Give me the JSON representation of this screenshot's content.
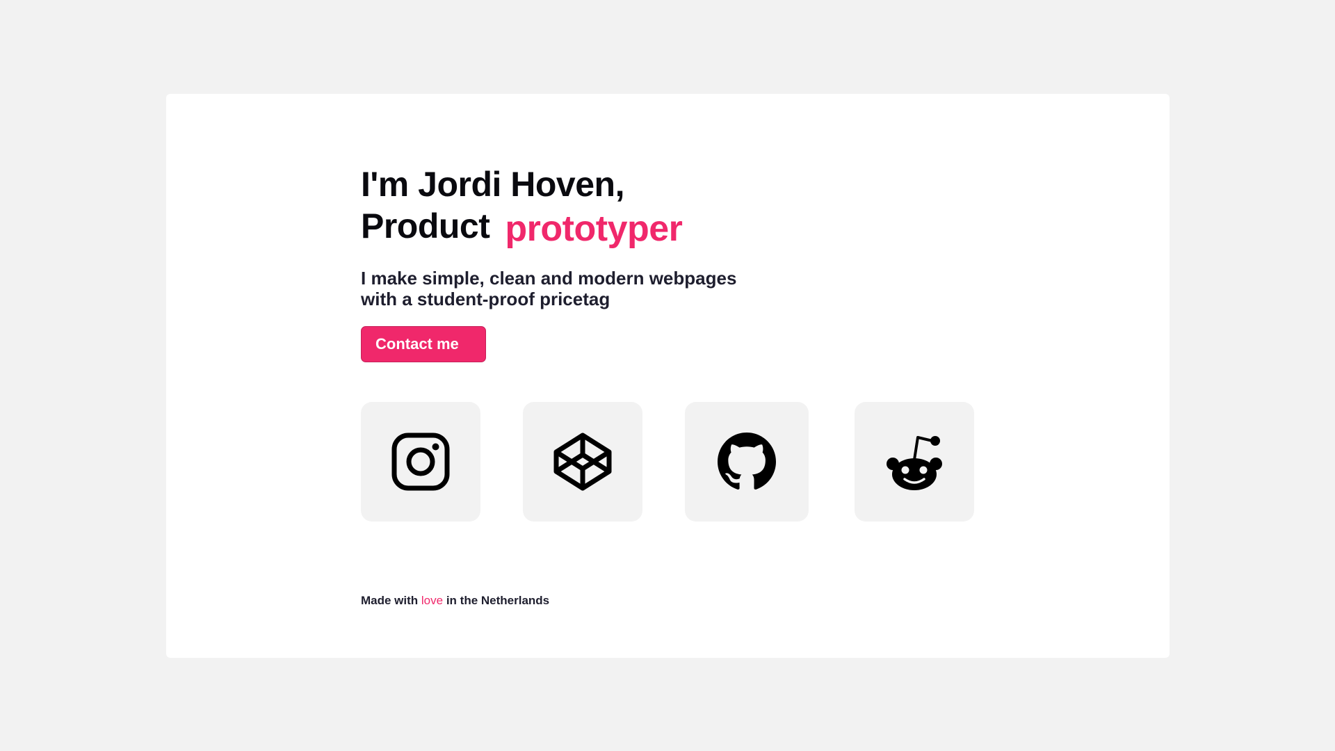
{
  "hero": {
    "line1": "I'm Jordi Hoven,",
    "line2_prefix": "Product",
    "line2_accent": "prototyper"
  },
  "tagline": {
    "line1": "I make simple, clean and modern webpages",
    "line2": "with a student-proof pricetag"
  },
  "cta": {
    "label": "Contact me"
  },
  "socials": [
    {
      "icon": "instagram-icon"
    },
    {
      "icon": "codepen-icon"
    },
    {
      "icon": "github-icon"
    },
    {
      "icon": "reddit-icon"
    }
  ],
  "footer": {
    "prefix": "Made with",
    "accent": "love",
    "suffix": "in the Netherlands"
  },
  "colors": {
    "accent": "#f0286b",
    "background": "#f2f2f2",
    "card": "#ffffff",
    "text": "#0a0a0f"
  }
}
